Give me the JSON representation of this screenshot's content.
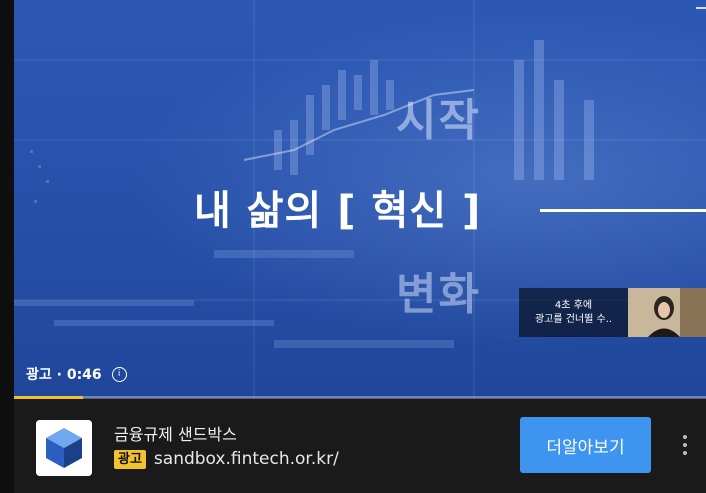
{
  "video": {
    "slogan_top": "시작",
    "headline": "내 삶의 [  혁신  ]",
    "slogan_bottom": "변화",
    "skip_notice_line1": "4초 후에",
    "skip_notice_line2": "광고를 건너뛸 수..",
    "ad_label": "광고 · 0:46",
    "info_glyph": "i",
    "progress_fraction": 0.1
  },
  "ad_bar": {
    "advertiser_name": "금융규제 샌드박스",
    "ad_badge": "광고",
    "ad_url": "sandbox.fintech.or.kr/",
    "cta_label": "더알아보기"
  },
  "colors": {
    "accent_yellow": "#f2c230",
    "cta_blue": "#3e95f0",
    "video_blue": "#2a55b0"
  },
  "icons": [
    "info-icon",
    "more-vert-icon",
    "expand-icon",
    "cube-logo-icon"
  ]
}
